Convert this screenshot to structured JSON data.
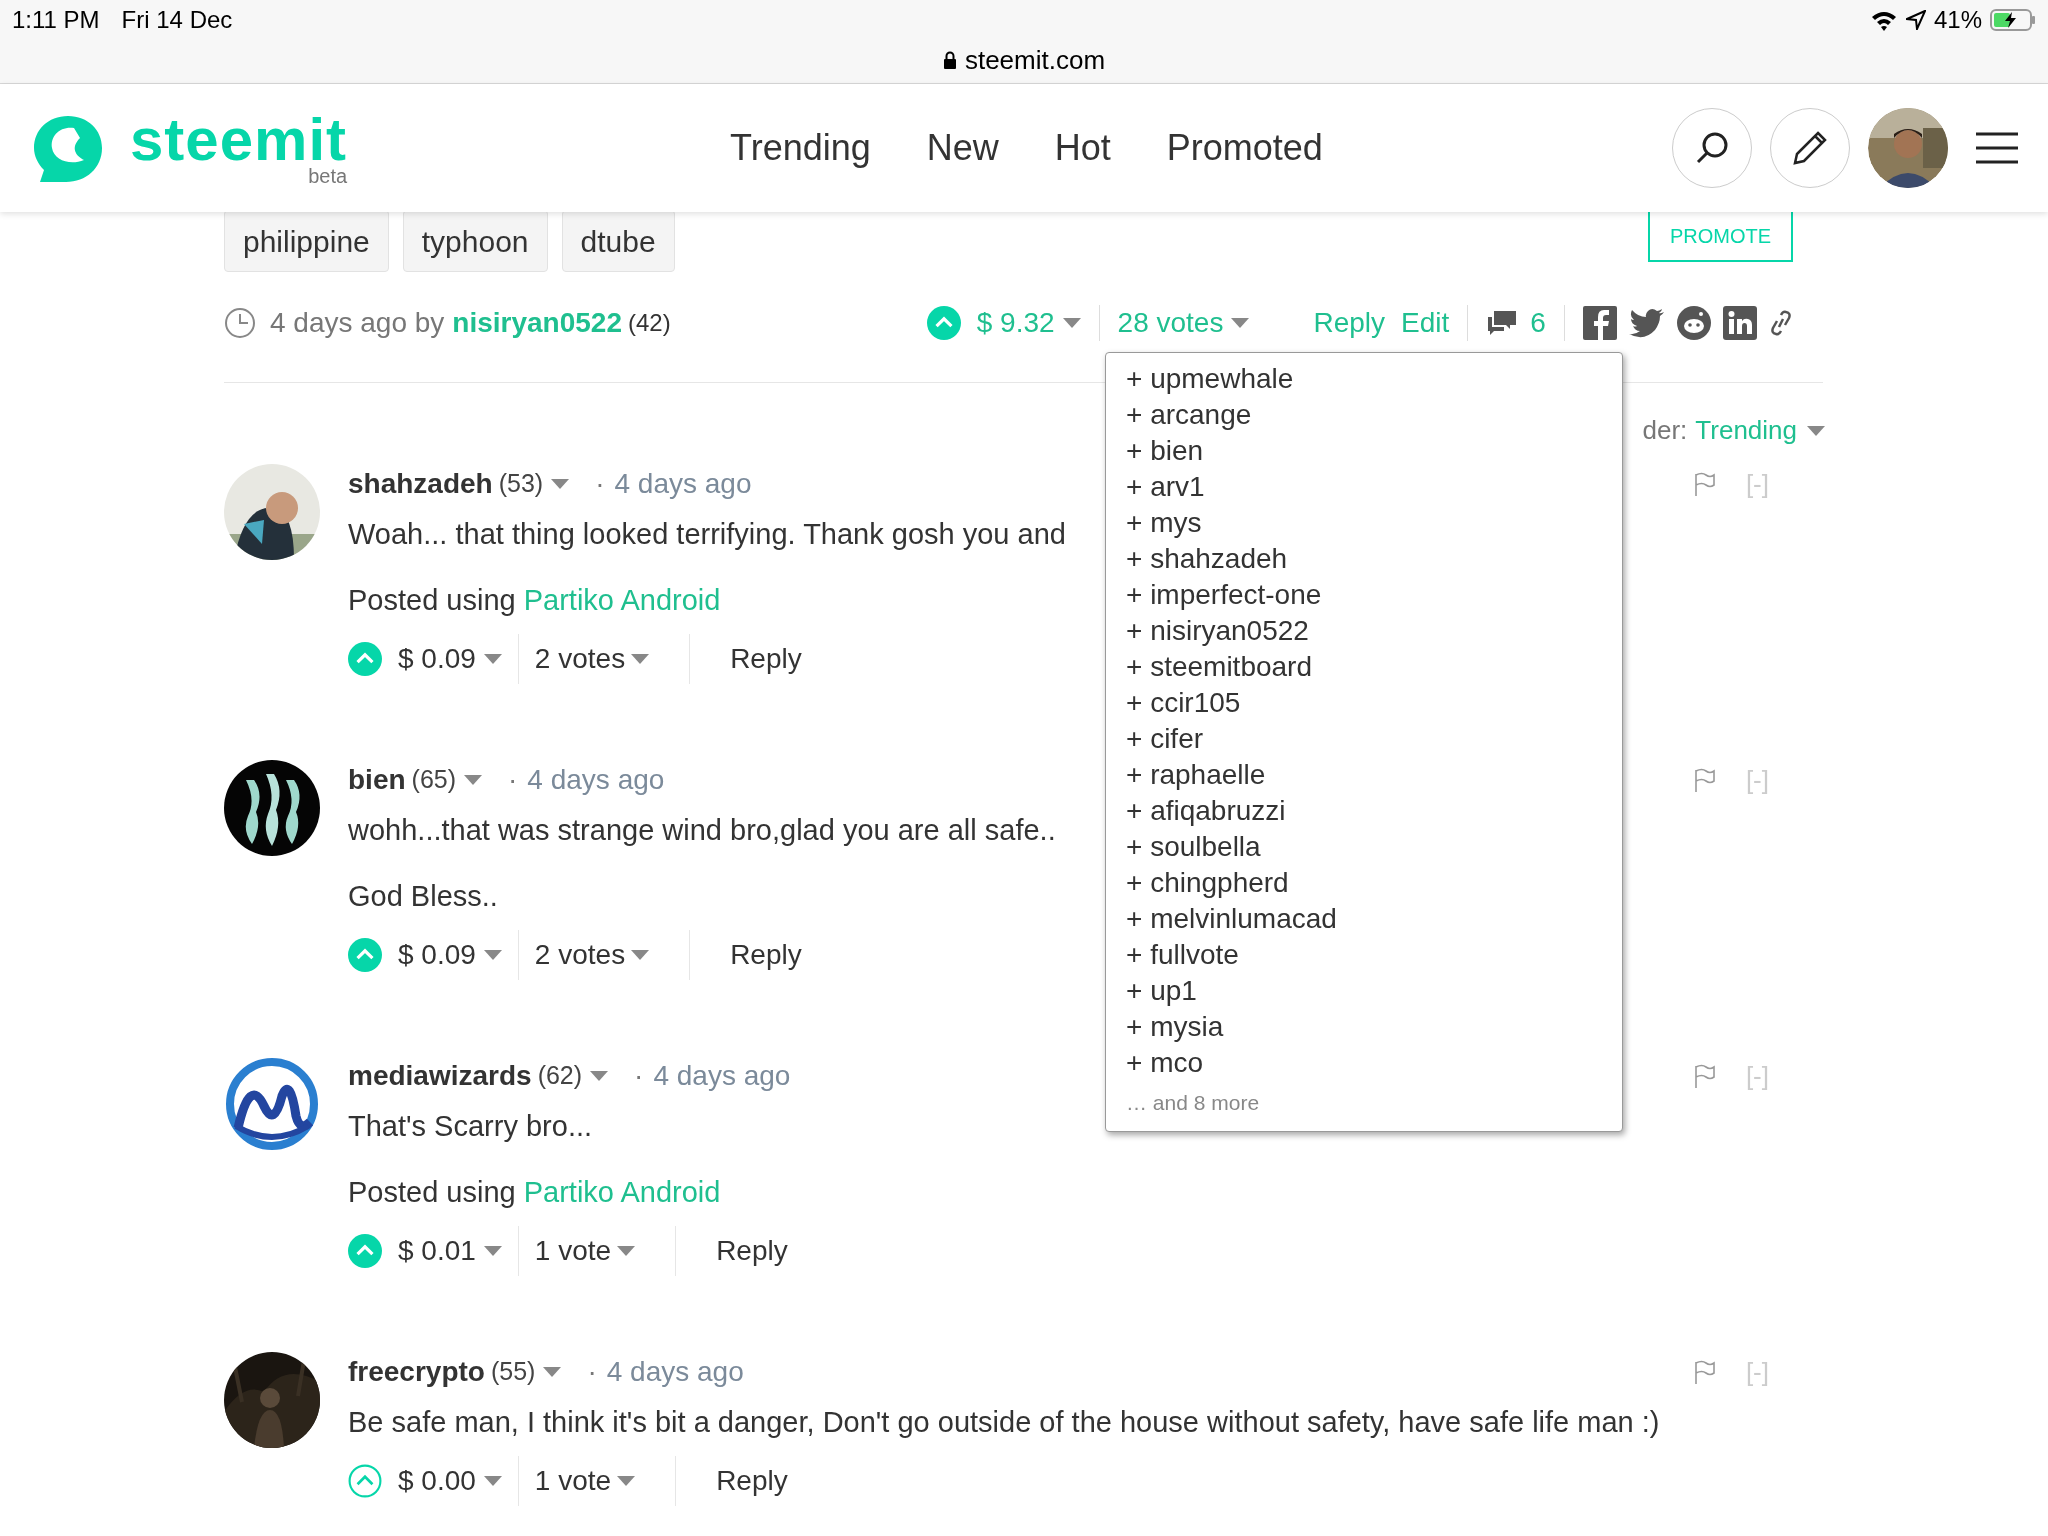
{
  "status_bar": {
    "time": "1:11 PM",
    "date": "Fri 14 Dec",
    "battery": "41%"
  },
  "url_bar": {
    "url": "steemit.com"
  },
  "header": {
    "logo": "steemit",
    "logo_sub": "beta",
    "nav": [
      "Trending",
      "New",
      "Hot",
      "Promoted"
    ]
  },
  "post": {
    "tags": [
      "philippine",
      "typhoon",
      "dtube"
    ],
    "promote": "PROMOTE",
    "age": "4 days ago by",
    "author": "nisiryan0522",
    "reputation": "(42)",
    "voted": true,
    "payout": "$ 9.32",
    "votes": "28 votes",
    "actions": [
      "Reply",
      "Edit"
    ],
    "comment_count": "6"
  },
  "voters_dropdown": {
    "items": [
      "+ upmewhale",
      "+ arcange",
      "+ bien",
      "+ arv1",
      "+ mys",
      "+ shahzadeh",
      "+ imperfect-one",
      "+ nisiryan0522",
      "+ steemitboard",
      "+ ccir105",
      "+ cifer",
      "+ raphaelle",
      "+ afiqabruzzi",
      "+ soulbella",
      "+ chingpherd",
      "+ melvinlumacad",
      "+ fullvote",
      "+ up1",
      "+ mysia",
      "+ mco"
    ],
    "more": "… and 8 more"
  },
  "sort": {
    "label": "der:",
    "value": "Trending"
  },
  "comments": [
    {
      "author": "shahzadeh",
      "reputation": "(53)",
      "dot": "·",
      "age": "4 days ago",
      "paragraphs": [
        {
          "text": "Woah... that thing looked terrifying. Thank gosh you and"
        },
        {
          "text": "Posted using",
          "link": "Partiko Android"
        }
      ],
      "voted": true,
      "payout": "$ 0.09",
      "votes": "2 votes",
      "reply": "Reply",
      "collapse": "[-]"
    },
    {
      "author": "bien",
      "reputation": "(65)",
      "dot": "·",
      "age": "4 days ago",
      "paragraphs": [
        {
          "text": "wohh...that was strange wind bro,glad you are all safe.."
        },
        {
          "text": "God Bless.."
        }
      ],
      "voted": true,
      "payout": "$ 0.09",
      "votes": "2 votes",
      "reply": "Reply",
      "collapse": "[-]"
    },
    {
      "author": "mediawizards",
      "reputation": "(62)",
      "dot": "·",
      "age": "4 days ago",
      "paragraphs": [
        {
          "text": "That's Scarry bro..."
        },
        {
          "text": "Posted using",
          "link": "Partiko Android"
        }
      ],
      "voted": true,
      "payout": "$ 0.01",
      "votes": "1 vote",
      "reply": "Reply",
      "collapse": "[-]"
    },
    {
      "author": "freecrypto",
      "reputation": "(55)",
      "dot": "·",
      "age": "4 days ago",
      "paragraphs": [
        {
          "text": "Be safe man, I think it's bit a danger, Don't go outside of the house without safety, have safe life man :)"
        }
      ],
      "voted": false,
      "payout": "$ 0.00",
      "votes": "1 vote",
      "reply": "Reply",
      "collapse": "[-]"
    }
  ]
}
